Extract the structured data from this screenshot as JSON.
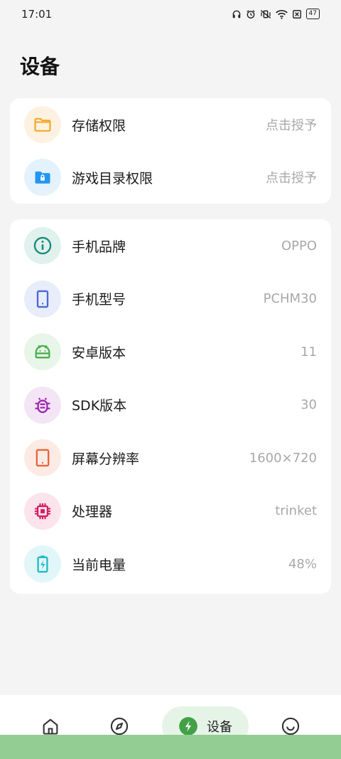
{
  "status_bar": {
    "time": "17:01",
    "battery": "47"
  },
  "page": {
    "title": "设备"
  },
  "permissions": [
    {
      "label": "存储权限",
      "value": "点击授予",
      "icon": "folder-icon",
      "color": "#f5a623",
      "bg": "#fdf1e1"
    },
    {
      "label": "游戏目录权限",
      "value": "点击授予",
      "icon": "folder-lock-icon",
      "color": "#2196f3",
      "bg": "#e3f2fd"
    }
  ],
  "device_info": [
    {
      "label": "手机品牌",
      "value": "OPPO",
      "icon": "info-icon",
      "color": "#168b7a",
      "bg": "#e0f1ee"
    },
    {
      "label": "手机型号",
      "value": "PCHM30",
      "icon": "phone-icon",
      "color": "#4a67d6",
      "bg": "#e8ecfb"
    },
    {
      "label": "安卓版本",
      "value": "11",
      "icon": "android-icon",
      "color": "#4caf50",
      "bg": "#e8f5e9"
    },
    {
      "label": "SDK版本",
      "value": "30",
      "icon": "bug-icon",
      "color": "#9c27b0",
      "bg": "#f3e5f5"
    },
    {
      "label": "屏幕分辨率",
      "value": "1600×720",
      "icon": "tablet-icon",
      "color": "#e8663a",
      "bg": "#fcebe4"
    },
    {
      "label": "处理器",
      "value": "trinket",
      "icon": "chip-icon",
      "color": "#d81b60",
      "bg": "#fce4ec"
    },
    {
      "label": "当前电量",
      "value": "48%",
      "icon": "battery-charging-icon",
      "color": "#26b5c8",
      "bg": "#e0f6f9"
    }
  ],
  "bottom_nav": {
    "device_label": "设备",
    "active_color": "#43a047",
    "active_bg": "#e6f4e8"
  }
}
